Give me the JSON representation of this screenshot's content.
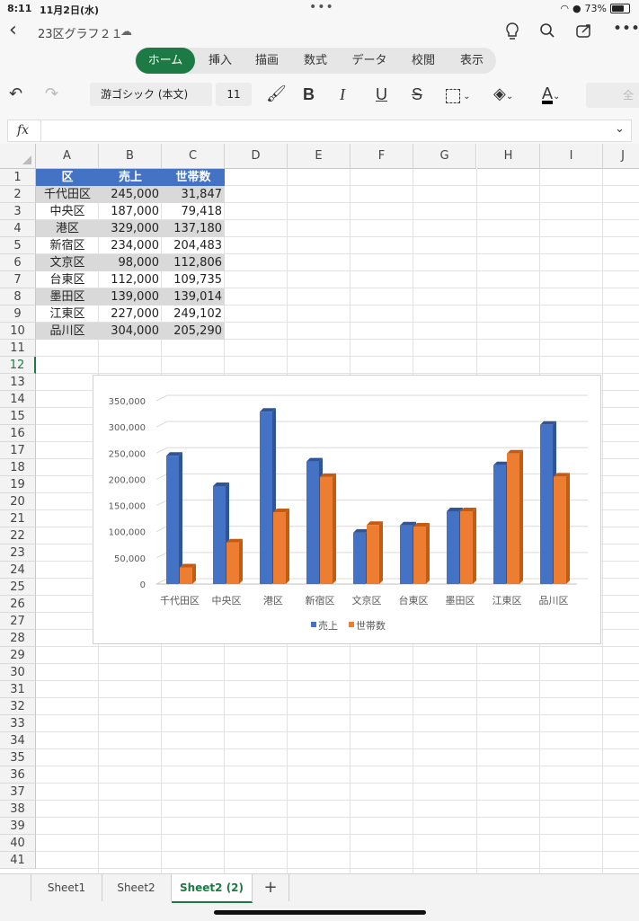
{
  "status": {
    "time": "8:11",
    "date": "11月2日(水)",
    "battery": "73%"
  },
  "titlebar": {
    "title": "23区グラフ２１"
  },
  "tabs": [
    "ホーム",
    "挿入",
    "描画",
    "数式",
    "データ",
    "校閲",
    "表示"
  ],
  "toolbar": {
    "font": "游ゴシック (本文)",
    "size": "11",
    "bold": "B",
    "italic": "I",
    "underline": "U",
    "strike": "S",
    "overflow": "全"
  },
  "formula": {
    "label": "fx",
    "value": ""
  },
  "columns": [
    "A",
    "B",
    "C",
    "D",
    "E",
    "F",
    "G",
    "H",
    "I",
    "J"
  ],
  "rows": [
    "1",
    "2",
    "3",
    "4",
    "5",
    "6",
    "7",
    "8",
    "9",
    "10",
    "11",
    "12",
    "13",
    "14",
    "15",
    "16",
    "17",
    "18",
    "19",
    "20",
    "21",
    "22",
    "23",
    "24",
    "25",
    "26",
    "27",
    "28",
    "29",
    "30",
    "31",
    "32",
    "33",
    "34",
    "35",
    "36",
    "37",
    "38",
    "39",
    "40",
    "41"
  ],
  "table": {
    "headers": [
      "区",
      "売上",
      "世帯数"
    ],
    "rows": [
      [
        "千代田区",
        "245,000",
        "31,847"
      ],
      [
        "中央区",
        "187,000",
        "79,418"
      ],
      [
        "港区",
        "329,000",
        "137,180"
      ],
      [
        "新宿区",
        "234,000",
        "204,483"
      ],
      [
        "文京区",
        "98,000",
        "112,806"
      ],
      [
        "台東区",
        "112,000",
        "109,735"
      ],
      [
        "墨田区",
        "139,000",
        "139,014"
      ],
      [
        "江東区",
        "227,000",
        "249,102"
      ],
      [
        "品川区",
        "304,000",
        "205,290"
      ]
    ]
  },
  "chart_data": {
    "type": "bar",
    "categories": [
      "千代田区",
      "中央区",
      "港区",
      "新宿区",
      "文京区",
      "台東区",
      "墨田区",
      "江東区",
      "品川区"
    ],
    "series": [
      {
        "name": "売上",
        "values": [
          245000,
          187000,
          329000,
          234000,
          98000,
          112000,
          139000,
          227000,
          304000
        ],
        "color": "#4472c4"
      },
      {
        "name": "世帯数",
        "values": [
          31847,
          79418,
          137180,
          204483,
          112806,
          109735,
          139014,
          249102,
          205290
        ],
        "color": "#ed7d31"
      }
    ],
    "ylim": [
      0,
      350000
    ],
    "yticks": [
      "0",
      "50,000",
      "100,000",
      "150,000",
      "200,000",
      "250,000",
      "300,000",
      "350,000"
    ],
    "grid": true,
    "legend": "bottom"
  },
  "sheets": [
    "Sheet1",
    "Sheet2",
    "Sheet2 (2)"
  ],
  "add_sheet": "+"
}
